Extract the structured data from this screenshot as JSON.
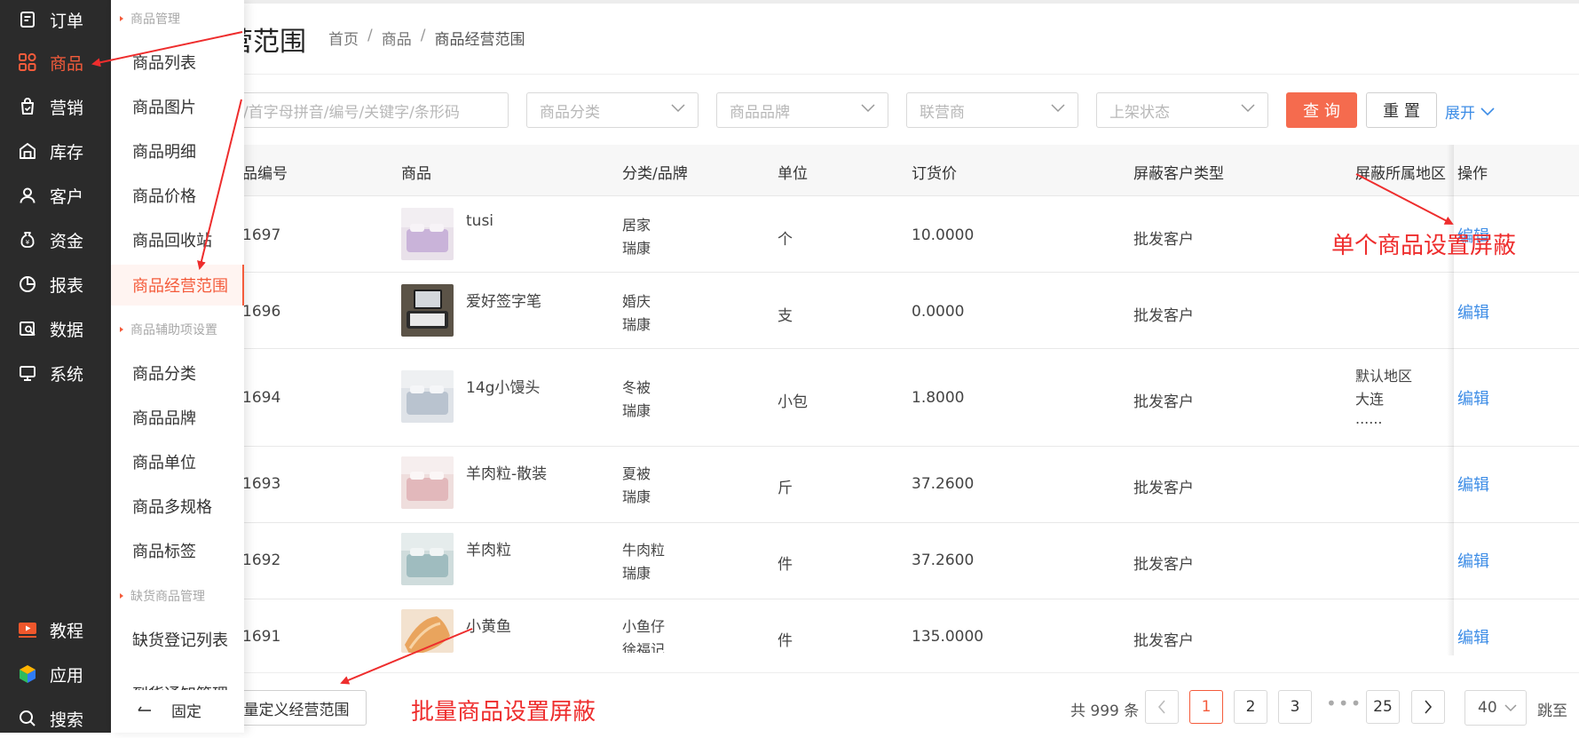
{
  "sidebar": {
    "items": [
      {
        "label": "订单",
        "icon": "order-icon"
      },
      {
        "label": "商品",
        "icon": "goods-icon",
        "active": true
      },
      {
        "label": "营销",
        "icon": "marketing-icon"
      },
      {
        "label": "库存",
        "icon": "inventory-icon"
      },
      {
        "label": "客户",
        "icon": "customer-icon"
      },
      {
        "label": "资金",
        "icon": "funds-icon"
      },
      {
        "label": "报表",
        "icon": "report-icon"
      },
      {
        "label": "数据",
        "icon": "data-icon"
      },
      {
        "label": "系统",
        "icon": "system-icon"
      }
    ],
    "bottom": [
      {
        "label": "教程",
        "icon": "tutorial-icon"
      },
      {
        "label": "应用",
        "icon": "apps-icon"
      },
      {
        "label": "搜索",
        "icon": "search-icon"
      }
    ]
  },
  "submenu": {
    "sections": [
      "商品管理",
      "商品辅助项设置",
      "缺货商品管理"
    ],
    "goods_items": [
      "商品列表",
      "商品图片",
      "商品明细",
      "商品价格",
      "商品回收站",
      "商品经营范围"
    ],
    "aux_items": [
      "商品分类",
      "商品品牌",
      "商品单位",
      "商品多规格",
      "商品标签"
    ],
    "stock_items": [
      "缺货登记列表",
      "到货通知管理"
    ],
    "pin_label": "固定"
  },
  "header": {
    "title": "营范围",
    "breadcrumb": [
      "首页",
      "商品",
      "商品经营范围"
    ]
  },
  "filters": {
    "search_placeholder": "/首字母拼音/编号/关键字/条形码",
    "category_placeholder": "商品分类",
    "brand_placeholder": "商品品牌",
    "partner_placeholder": "联营商",
    "status_placeholder": "上架状态",
    "query_label": "查 询",
    "reset_label": "重 置",
    "expand_label": "展开"
  },
  "table": {
    "columns": [
      "品编号",
      "商品",
      "分类/品牌",
      "单位",
      "订货价",
      "屏蔽客户类型",
      "屏蔽所属地区",
      "操作"
    ],
    "rows": [
      {
        "code": "1697",
        "name": "tusi",
        "category": "居家",
        "brand": "瑞康",
        "unit": "个",
        "price": "10.0000",
        "customer_type": "批发客户",
        "region": [
          "",
          "",
          ""
        ],
        "action": "编辑"
      },
      {
        "code": "1696",
        "name": "爱好签字笔",
        "category": "婚庆",
        "brand": "瑞康",
        "unit": "支",
        "price": "0.0000",
        "customer_type": "批发客户",
        "region": [
          "",
          "",
          ""
        ],
        "action": "编辑"
      },
      {
        "code": "1694",
        "name": "14g小馒头",
        "category": "冬被",
        "brand": "瑞康",
        "unit": "小包",
        "price": "1.8000",
        "customer_type": "批发客户",
        "region": [
          "默认地区",
          "大连",
          "......"
        ],
        "action": "编辑"
      },
      {
        "code": "1693",
        "name": "羊肉粒-散装",
        "category": "夏被",
        "brand": "瑞康",
        "unit": "斤",
        "price": "37.2600",
        "customer_type": "批发客户",
        "region": [
          "",
          "",
          ""
        ],
        "action": "编辑"
      },
      {
        "code": "1692",
        "name": "羊肉粒",
        "category": "牛肉粒",
        "brand": "瑞康",
        "unit": "件",
        "price": "37.2600",
        "customer_type": "批发客户",
        "region": [
          "",
          "",
          ""
        ],
        "action": "编辑"
      },
      {
        "code": "1691",
        "name": "小黄鱼",
        "category": "小鱼仔",
        "brand": "徐福记",
        "unit": "件",
        "price": "135.0000",
        "customer_type": "批发客户",
        "region": [
          "",
          "",
          ""
        ],
        "action": "编辑"
      }
    ]
  },
  "footer": {
    "batch_label": "量定义经营范围",
    "total": "共 999 条",
    "pages": [
      "1",
      "2",
      "3",
      "25"
    ],
    "ellipsis": "•••",
    "page_size": "40",
    "jump_label": "跳至"
  },
  "annotations": {
    "single": "单个商品设置屏蔽",
    "batch": "批量商品设置屏蔽"
  },
  "colors": {
    "accent": "#f45b3b",
    "link": "#3c8ce6",
    "annotation": "#ee2d2d",
    "sidebar_bg": "#2b2b2b"
  }
}
